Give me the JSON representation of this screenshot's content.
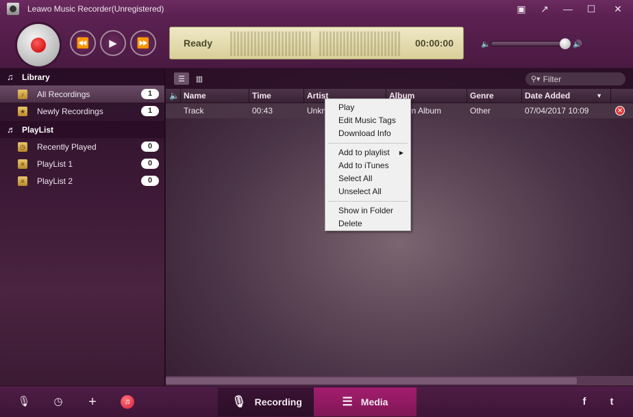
{
  "window": {
    "title": "Leawo Music Recorder(Unregistered)",
    "controls": [
      "▣",
      "↗",
      "—",
      "☐",
      "✕"
    ]
  },
  "player": {
    "status": "Ready",
    "time": "00:00:00"
  },
  "sidebar": {
    "library_header": "Library",
    "library_items": [
      {
        "label": "All Recordings",
        "count": "1"
      },
      {
        "label": "Newly Recordings",
        "count": "1"
      }
    ],
    "playlist_header": "PlayList",
    "playlist_items": [
      {
        "label": "Recently Played",
        "count": "0"
      },
      {
        "label": "PlayList 1",
        "count": "0"
      },
      {
        "label": "PlayList 2",
        "count": "0"
      }
    ]
  },
  "toolbar": {
    "filter_placeholder": "Filter"
  },
  "table": {
    "columns": [
      "Name",
      "Time",
      "Artist",
      "Album",
      "Genre",
      "Date Added"
    ],
    "rows": [
      {
        "name": "Track",
        "time": "00:43",
        "artist": "Unkn",
        "album": "wn Album",
        "genre": "Other",
        "date_added": "07/04/2017 10:09"
      }
    ]
  },
  "context_menu": {
    "items": [
      "Play",
      "Edit Music Tags",
      "Download Info"
    ],
    "items2": [
      "Add to playlist",
      "Add to iTunes",
      "Select All",
      "Unselect All"
    ],
    "items3": [
      "Show in Folder",
      "Delete"
    ]
  },
  "bottom": {
    "tab_recording": "Recording",
    "tab_media": "Media"
  },
  "colors": {
    "accent": "#a41d6e",
    "record": "#c00000"
  }
}
